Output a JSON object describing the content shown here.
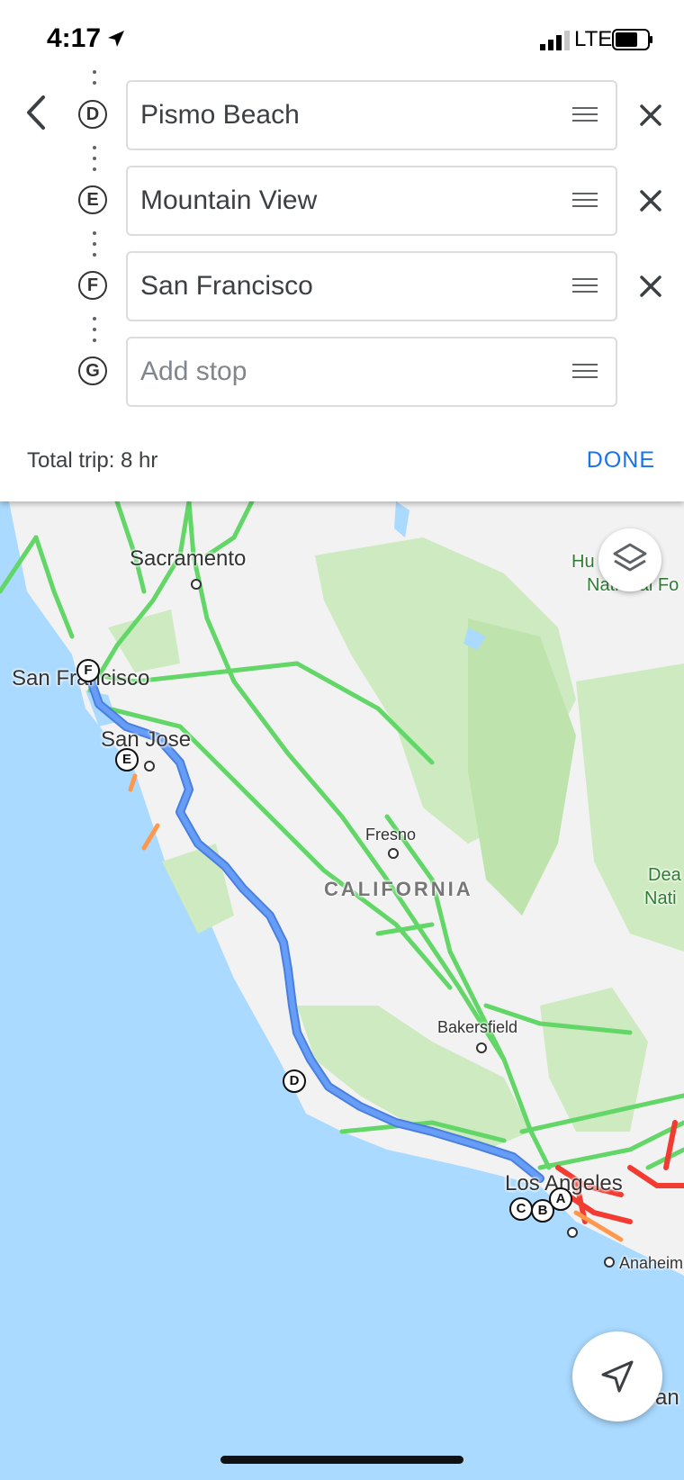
{
  "status_bar": {
    "time": "4:17",
    "network": "LTE"
  },
  "route": {
    "stops": [
      {
        "letter": "D",
        "value": "Pismo Beach",
        "placeholder": ""
      },
      {
        "letter": "E",
        "value": "Mountain View",
        "placeholder": ""
      },
      {
        "letter": "F",
        "value": "San Francisco",
        "placeholder": ""
      },
      {
        "letter": "G",
        "value": "",
        "placeholder": "Add stop"
      }
    ],
    "total_trip": "Total trip: 8 hr",
    "done_label": "DONE"
  },
  "map": {
    "labels": {
      "sacramento": "Sacramento",
      "san_francisco": "San Francisco",
      "san_jose": "San Jose",
      "fresno": "Fresno",
      "california": "CALIFORNIA",
      "bakersfield": "Bakersfield",
      "los_angeles": "Los Angeles",
      "anaheim": "Anaheim",
      "san_partial": "San",
      "humboldt_partial": "Hu        di-To",
      "national_partial": "National Fo",
      "death_valley_partial": "Dea",
      "nati_partial": "Nati"
    },
    "markers": {
      "a": "A",
      "b": "B",
      "c": "C",
      "d": "D",
      "e": "E",
      "f": "F"
    }
  },
  "colors": {
    "accent": "#1a73e8",
    "route": "#669df6",
    "water": "#aadaff",
    "land": "#f2f2f2",
    "park": "#cdeac0",
    "traffic_green": "#63d668",
    "traffic_red": "#f23c32"
  },
  "icons": {
    "back": "chevron-left-icon",
    "remove": "close-icon",
    "drag": "drag-handle-icon",
    "layers": "layers-icon",
    "navigate": "navigation-arrow-icon"
  }
}
